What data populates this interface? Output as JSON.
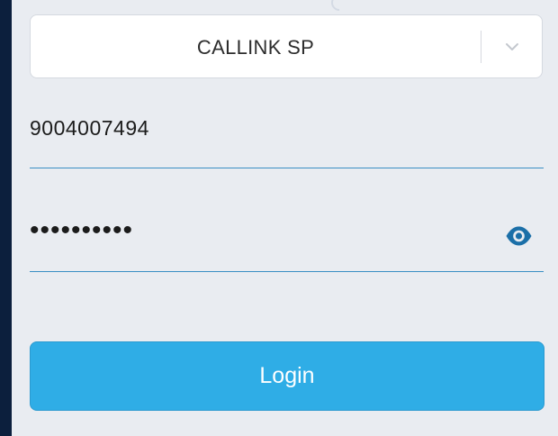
{
  "form": {
    "account_select": {
      "selected": "CALLINK SP"
    },
    "phone_field": {
      "value": "9004007494"
    },
    "password_field": {
      "masked_value": "••••••••••"
    },
    "login_button": {
      "label": "Login"
    }
  },
  "icons": {
    "select_chevron": "chevron-down-icon",
    "password_toggle": "eye-icon"
  },
  "colors": {
    "background": "#0c1f3d",
    "panel": "#e9ecf1",
    "accent": "#2fade6",
    "underline": "#3a8fc4",
    "eye": "#1b6fa8"
  }
}
